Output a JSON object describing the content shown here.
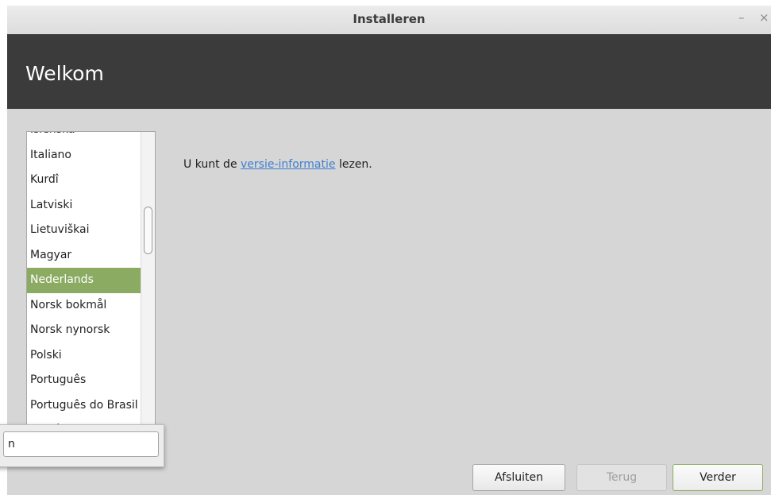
{
  "window": {
    "title": "Installeren",
    "minimize_label": "–",
    "close_label": "×"
  },
  "header": {
    "title": "Welkom"
  },
  "language_list": {
    "items": [
      "Íslenska",
      "Italiano",
      "Kurdî",
      "Latviski",
      "Lietuviškai",
      "Magyar",
      "Nederlands",
      "Norsk bokmål",
      "Norsk nynorsk",
      "Polski",
      "Português",
      "Português do Brasil",
      "Română"
    ],
    "selected": "Nederlands"
  },
  "info": {
    "prefix": "U kunt de ",
    "link": "versie-informatie",
    "suffix": " lezen."
  },
  "search": {
    "value": "n"
  },
  "buttons": {
    "quit": "Afsluiten",
    "back": "Terug",
    "next": "Verder"
  },
  "colors": {
    "accent": "#8bab62",
    "header_bg": "#3b3b3b",
    "link": "#3f7fd0"
  }
}
